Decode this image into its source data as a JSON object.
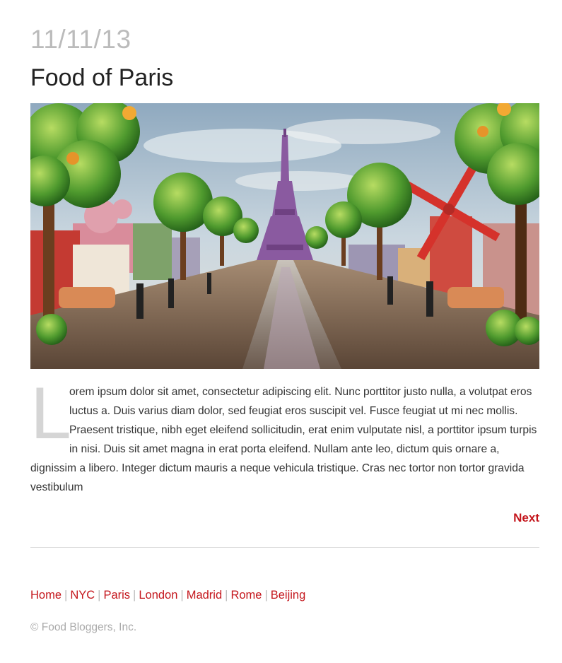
{
  "post": {
    "date": "11/11/13",
    "title": "Food of Paris",
    "drop_cap": "L",
    "body": "orem ipsum dolor sit amet, consectetur adipiscing elit. Nunc porttitor justo nulla, a volutpat eros luctus a. Duis varius diam dolor, sed feugiat eros suscipit vel. Fusce feugiat ut mi nec mollis. Praesent tristique, nibh eget eleifend sollicitudin, erat enim vulputate nisl, a porttitor ipsum turpis in nisi. Duis sit amet magna in erat porta eleifend. Nullam ante leo, dictum quis ornare a, dignissim a libero. Integer dictum mauris a neque vehicula tristique. Cras nec tortor non tortor gravida vestibulum",
    "next_label": "Next"
  },
  "footer": {
    "nav": [
      {
        "label": "Home"
      },
      {
        "label": "NYC"
      },
      {
        "label": "Paris"
      },
      {
        "label": "London"
      },
      {
        "label": "Madrid"
      },
      {
        "label": "Rome"
      },
      {
        "label": "Beijing"
      }
    ],
    "separator": "|",
    "copyright": "© Food Bloggers, Inc."
  },
  "colors": {
    "accent": "#c4161c",
    "date": "#bbbbbb",
    "divider": "#dddddd"
  }
}
